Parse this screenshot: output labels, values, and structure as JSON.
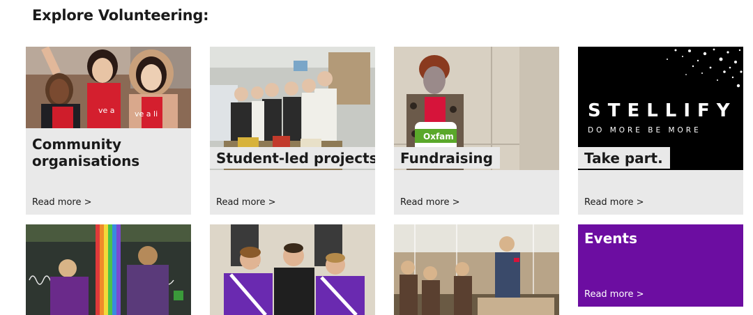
{
  "section_title": "Explore Volunteering:",
  "cards": [
    {
      "title_line1": "Community",
      "title_line2": "organisations",
      "link": "Read more >"
    },
    {
      "title": "Student-led projects",
      "link": "Read more >"
    },
    {
      "title": "Fundraising",
      "link": "Read more >",
      "bucket_text": "Oxfam"
    },
    {
      "title": "Take part.",
      "link": "Read more >",
      "logo_main": "STELLIFY",
      "logo_sub": "DO MORE BE MORE"
    },
    {
      "image": "children-rainbow-exhibit-photo"
    },
    {
      "image": "students-purple-kit-photo"
    },
    {
      "image": "museum-visit-photo"
    },
    {
      "title": "Events",
      "link": "Read more >"
    }
  ],
  "colors": {
    "card_bg": "#e9e9e9",
    "events_bg": "#6c0da1",
    "text": "#1a1a1a"
  }
}
